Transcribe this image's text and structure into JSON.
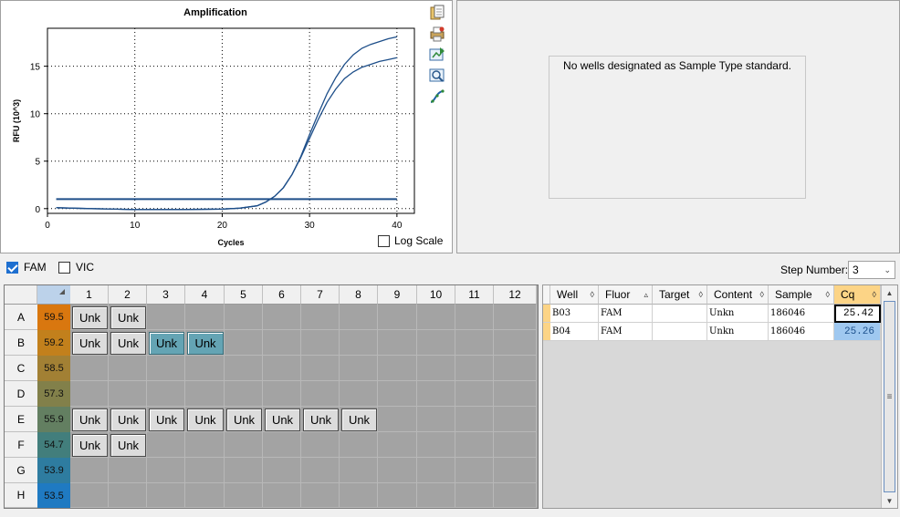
{
  "chart": {
    "title": "Amplification",
    "log_scale_label": "Log Scale"
  },
  "standard_panel": {
    "message": "No wells designated as Sample Type standard."
  },
  "fluor_bar": {
    "fam_label": "FAM",
    "vic_label": "VIC",
    "step_label": "Step Number:",
    "step_value": "3"
  },
  "plate": {
    "columns": [
      "1",
      "2",
      "3",
      "4",
      "5",
      "6",
      "7",
      "8",
      "9",
      "10",
      "11",
      "12"
    ],
    "rows": [
      {
        "letter": "A",
        "temp": "59.5",
        "temp_color": "#d9770f"
      },
      {
        "letter": "B",
        "temp": "59.2",
        "temp_color": "#c2801c"
      },
      {
        "letter": "C",
        "temp": "58.5",
        "temp_color": "#a28034"
      },
      {
        "letter": "D",
        "temp": "57.3",
        "temp_color": "#82804a"
      },
      {
        "letter": "E",
        "temp": "55.9",
        "temp_color": "#637f61"
      },
      {
        "letter": "F",
        "temp": "54.7",
        "temp_color": "#427e7c"
      },
      {
        "letter": "G",
        "temp": "53.9",
        "temp_color": "#2e7ca0"
      },
      {
        "letter": "H",
        "temp": "53.5",
        "temp_color": "#1f7ac2"
      }
    ],
    "wells": [
      {
        "row": 0,
        "col": 0,
        "label": "Unk",
        "selected": false
      },
      {
        "row": 0,
        "col": 1,
        "label": "Unk",
        "selected": false
      },
      {
        "row": 1,
        "col": 0,
        "label": "Unk",
        "selected": false
      },
      {
        "row": 1,
        "col": 1,
        "label": "Unk",
        "selected": false
      },
      {
        "row": 1,
        "col": 2,
        "label": "Unk",
        "selected": true
      },
      {
        "row": 1,
        "col": 3,
        "label": "Unk",
        "selected": true
      },
      {
        "row": 4,
        "col": 0,
        "label": "Unk",
        "selected": false
      },
      {
        "row": 4,
        "col": 1,
        "label": "Unk",
        "selected": false
      },
      {
        "row": 4,
        "col": 2,
        "label": "Unk",
        "selected": false
      },
      {
        "row": 4,
        "col": 3,
        "label": "Unk",
        "selected": false
      },
      {
        "row": 4,
        "col": 4,
        "label": "Unk",
        "selected": false
      },
      {
        "row": 4,
        "col": 5,
        "label": "Unk",
        "selected": false
      },
      {
        "row": 4,
        "col": 6,
        "label": "Unk",
        "selected": false
      },
      {
        "row": 4,
        "col": 7,
        "label": "Unk",
        "selected": false
      },
      {
        "row": 5,
        "col": 0,
        "label": "Unk",
        "selected": false
      },
      {
        "row": 5,
        "col": 1,
        "label": "Unk",
        "selected": false
      }
    ]
  },
  "results_table": {
    "headers": [
      "Well",
      "Fluor",
      "Target",
      "Content",
      "Sample",
      "Cq"
    ],
    "sort_glyphs": [
      "◊",
      "▵",
      "◊",
      "◊",
      "◊",
      "◊"
    ],
    "rows": [
      {
        "well": "B03",
        "fluor": "FAM",
        "target": "",
        "content": "Unkn",
        "sample": "186046",
        "cq": "25.42"
      },
      {
        "well": "B04",
        "fluor": "FAM",
        "target": "",
        "content": "Unkn",
        "sample": "186046",
        "cq": "25.26"
      }
    ]
  },
  "chart_data": {
    "type": "line",
    "title": "Amplification",
    "xlabel": "Cycles",
    "ylabel": "RFU (10^3)",
    "xlim": [
      0,
      42
    ],
    "ylim": [
      -0.5,
      19
    ],
    "xticks": [
      0,
      10,
      20,
      30,
      40
    ],
    "yticks": [
      0,
      5,
      10,
      15
    ],
    "grid": true,
    "series_color": "#1d4e89",
    "threshold": 1.0,
    "series": [
      {
        "name": "",
        "x": [
          1,
          5,
          10,
          15,
          20,
          22,
          24,
          25,
          26,
          27,
          28,
          29,
          30,
          31,
          32,
          33,
          34,
          35,
          36,
          37,
          38,
          39,
          40
        ],
        "y": [
          0.1,
          0.0,
          -0.1,
          -0.1,
          -0.05,
          0.05,
          0.3,
          0.7,
          1.3,
          2.2,
          3.6,
          5.5,
          7.8,
          10.0,
          12.1,
          13.8,
          15.2,
          16.2,
          16.9,
          17.3,
          17.6,
          17.9,
          18.1
        ]
      },
      {
        "name": "",
        "x": [
          1,
          5,
          10,
          15,
          20,
          22,
          24,
          25,
          26,
          27,
          28,
          29,
          30,
          31,
          32,
          33,
          34,
          35,
          36,
          37,
          38,
          39,
          40
        ],
        "y": [
          0.1,
          0.0,
          -0.1,
          -0.1,
          -0.05,
          0.05,
          0.3,
          0.7,
          1.3,
          2.2,
          3.6,
          5.4,
          7.4,
          9.4,
          11.2,
          12.6,
          13.7,
          14.4,
          14.9,
          15.2,
          15.5,
          15.7,
          15.9
        ]
      }
    ]
  }
}
